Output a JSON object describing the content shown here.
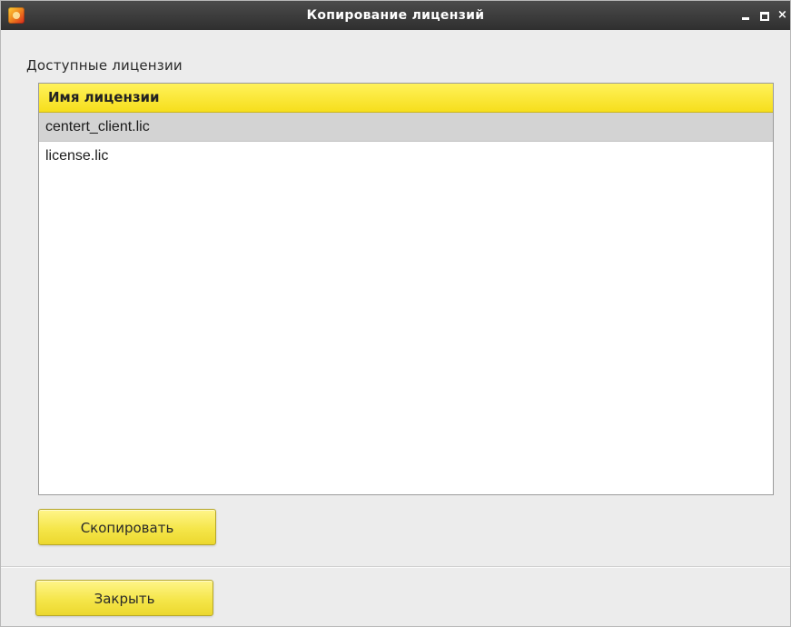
{
  "window": {
    "title": "Копирование лицензий",
    "controls": {
      "minimize": "minimize-icon",
      "maximize": "maximize-icon",
      "close": "close-icon",
      "close_glyph": "×"
    },
    "app_icon": "app-logo-icon"
  },
  "licenses": {
    "section_label": "Доступные лицензии",
    "column_header": "Имя лицензии",
    "rows": [
      {
        "name": "centert_client.lic",
        "selected": true
      },
      {
        "name": "license.lic",
        "selected": false
      }
    ]
  },
  "buttons": {
    "copy_label": "Скопировать",
    "close_label": "Закрыть"
  },
  "colors": {
    "header_yellow": "#f6de1c",
    "button_yellow": "#f5e64a",
    "titlebar": "#3a3a3a",
    "selected_row": "#d3d3d3"
  }
}
